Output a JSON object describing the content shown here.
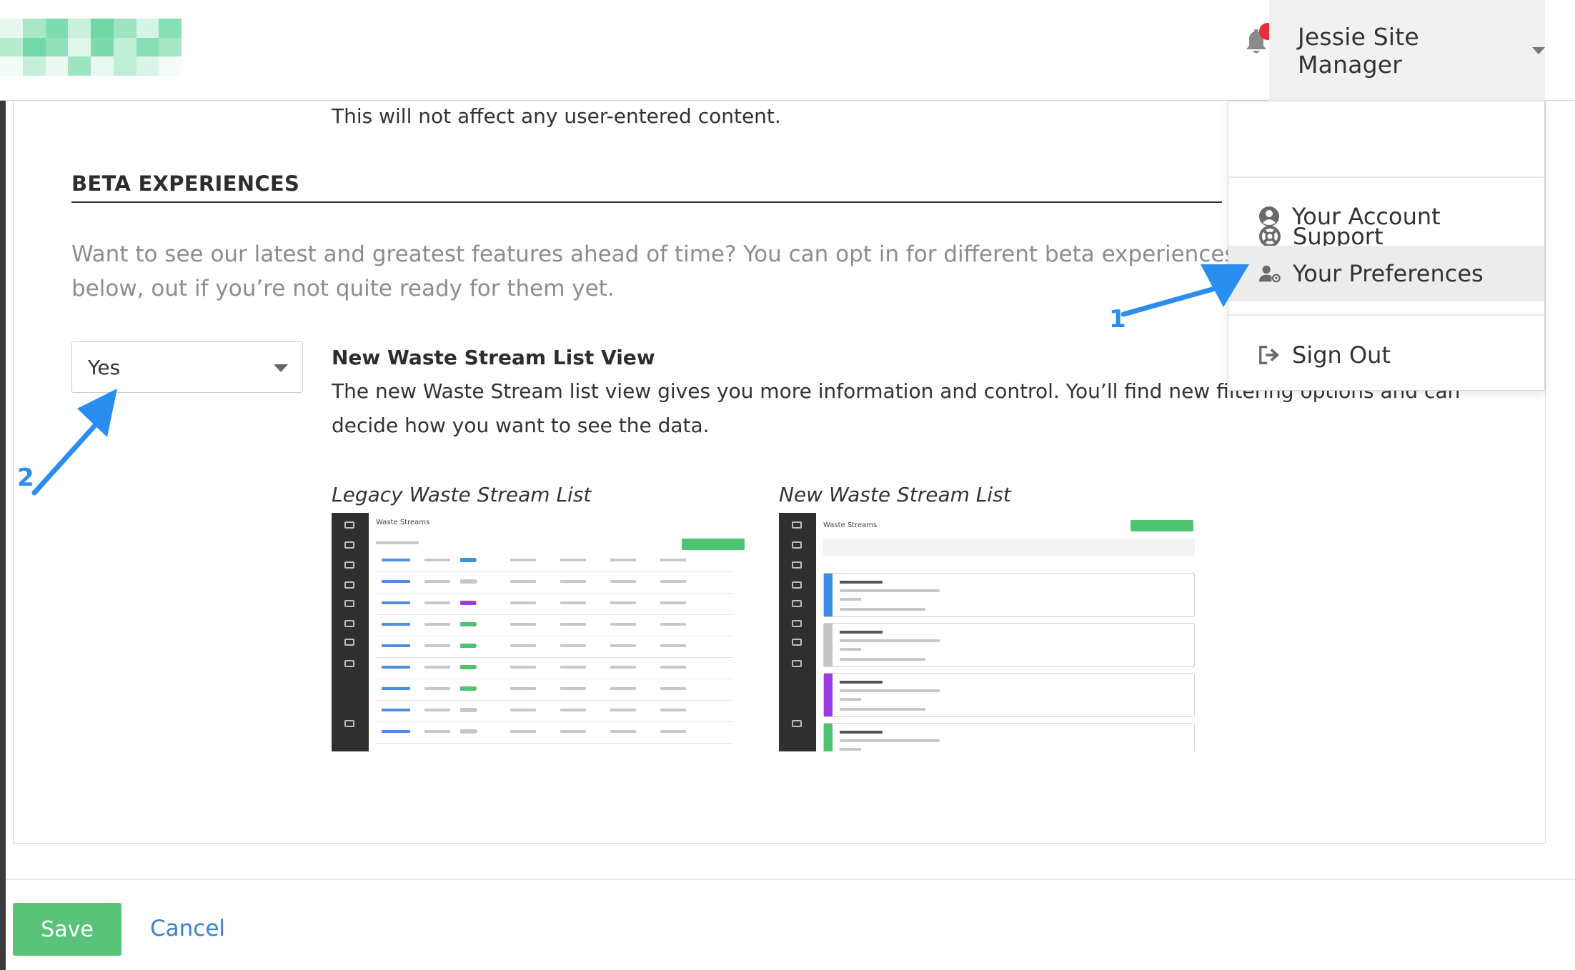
{
  "header": {
    "user_name": "Jessie Site Manager",
    "notification_badge_color": "#ee2b3b",
    "bell_icon": "bell-icon",
    "caret_icon": "chevron-down-icon"
  },
  "page": {
    "intro_text": "This will not affect any user-entered content.",
    "section_title": "BETA EXPERIENCES",
    "section_desc": "Want to see our latest and greatest features ahead of time? You can opt in for different beta experiences below, out if you’re not quite ready for them yet.",
    "feature": {
      "select_value": "Yes",
      "title": "New Waste Stream List View",
      "description": "The new Waste Stream list view gives you more information and control. You’ll find new filtering options and can decide how you want to see the data.",
      "legacy_label": "Legacy Waste Stream List",
      "new_label": "New Waste Stream List",
      "legacy_shot_header": "Waste Streams",
      "new_shot_header": "Waste Streams"
    }
  },
  "dropdown": {
    "items": [
      {
        "label": "Support",
        "icon": "lifebuoy-icon"
      },
      {
        "label": "Your Account",
        "icon": "user-circle-icon"
      },
      {
        "label": "Your Preferences",
        "icon": "user-gear-icon"
      },
      {
        "label": "Sign Out",
        "icon": "sign-out-icon"
      }
    ]
  },
  "footer": {
    "save_label": "Save",
    "cancel_label": "Cancel"
  },
  "annotations": {
    "arrow_1_label": "1",
    "arrow_2_label": "2",
    "arrow_color": "#2a8df0"
  },
  "colors": {
    "accent_green": "#5ac37a",
    "link_blue": "#3a82c8"
  }
}
